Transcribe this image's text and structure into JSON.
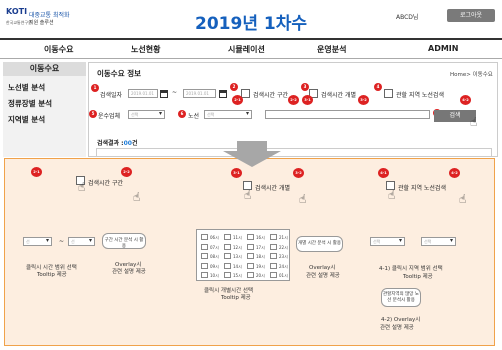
{
  "header": {
    "logo_mark": "KOTI",
    "logo_sub": "한국교통연구원",
    "logo_title": "대중교통 최적화",
    "logo_subtitle": "지원 솔루션",
    "title": "2019년 1차수",
    "user": "ABCD님",
    "logout_label": "로그아웃"
  },
  "nav": [
    "이동수요",
    "노선현황",
    "시뮬레이션",
    "운영분석",
    "ADMIN"
  ],
  "sidebar": {
    "header": "이동수요",
    "items": [
      "노선별 분석",
      "정류장별 분석",
      "지역별 분석"
    ]
  },
  "page": {
    "title": "이동수요 정보",
    "breadcrumb": "Home> 이동수요"
  },
  "search": {
    "date_label": "검색일자",
    "date_from": "2019.01.01",
    "tilde": "~",
    "date_to": "2019.01.01",
    "time_range_label": "검색시간 구간",
    "time_each_label": "검색시간 개별",
    "region_label": "관할 지역 노선검색",
    "operator_label": "운수업체",
    "operator_value": "선택",
    "route_label": "노선",
    "route_value": "선택",
    "search_button": "검색"
  },
  "badges": {
    "b1": "1",
    "b2": "2",
    "b3": "3",
    "b4": "4",
    "b5": "5",
    "b6": "6",
    "b7": "7",
    "b21": "2-1",
    "b22": "2-2",
    "b31": "3-1",
    "b32": "3-2",
    "b41": "4-1",
    "b42": "4-2"
  },
  "result": {
    "label": "검색결과 :",
    "count": "00",
    "unit": "건"
  },
  "detail": {
    "time_range_label": "검색시간 구간",
    "time_each_label": "검색시간 개별",
    "region_label": "관할 지역 노선검색",
    "range_from": "선",
    "range_to": "선",
    "range_tilde": "~",
    "range_cap1": "클릭시 시간 범위 선택",
    "range_cap2": "Tooltip 제공",
    "range_pop": "구간 시간 분석 시 활용",
    "overlay_cap1": "Overlay시",
    "overlay_cap2": "관련 설명 제공",
    "each_pop": "개별 시간 분석 시 활용",
    "each_cap1": "클릭시 개별시간 선택",
    "each_cap2": "Tooltip 제공",
    "region_cap1": "4-1) 클릭시 지역 범위 선택",
    "region_cap2": "Tooltip 제공",
    "region_pop": "관할지역의 많망 노선 분석시 활용",
    "region_ov1": "4-2) Overlay시",
    "region_ov2": "관련 설명 제공",
    "sel1": "선택",
    "sel2": "선택",
    "hours": [
      "06시",
      "07시",
      "08시",
      "09시",
      "10시",
      "11시",
      "12시",
      "13시",
      "14시",
      "15시",
      "16시",
      "17시",
      "18시",
      "19시",
      "20시",
      "21시",
      "22시",
      "23시",
      "24시",
      "01시"
    ]
  }
}
